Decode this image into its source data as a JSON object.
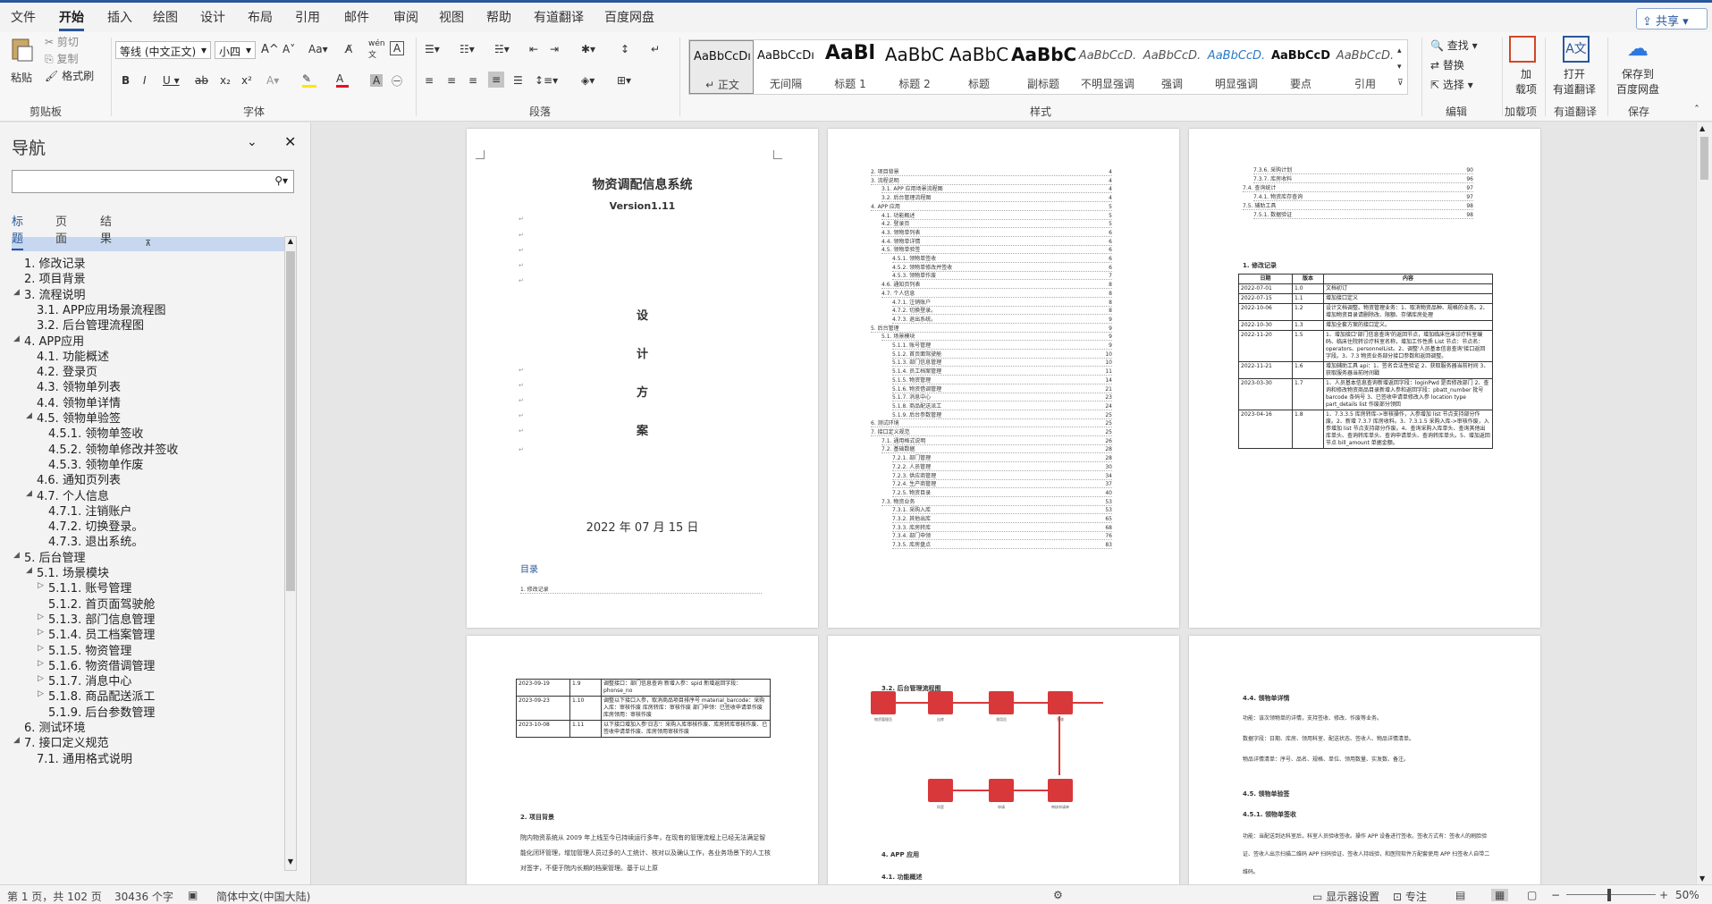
{
  "menu": {
    "tabs": [
      "文件",
      "开始",
      "插入",
      "绘图",
      "设计",
      "布局",
      "引用",
      "邮件",
      "审阅",
      "视图",
      "帮助",
      "有道翻译",
      "百度网盘"
    ],
    "active_tab": "开始",
    "share": "共享"
  },
  "ribbon": {
    "clipboard": {
      "paste": "粘贴",
      "cut": "剪切",
      "copy": "复制",
      "format_painter": "格式刷",
      "label": "剪贴板"
    },
    "font": {
      "name": "等线 (中文正文)",
      "size": "小四",
      "label": "字体",
      "wen": "wén"
    },
    "paragraph": {
      "label": "段落"
    },
    "styles": {
      "label": "样式",
      "items": [
        {
          "preview": "AaBbCcDı",
          "name": "正文"
        },
        {
          "preview": "AaBbCcDı",
          "name": "无间隔"
        },
        {
          "preview": "AaBl",
          "name": "标题 1"
        },
        {
          "preview": "AaBbC",
          "name": "标题 2"
        },
        {
          "preview": "AaBbC",
          "name": "标题"
        },
        {
          "preview": "AaBbC",
          "name": "副标题"
        },
        {
          "preview": "AaBbCcD.",
          "name": "不明显强调"
        },
        {
          "preview": "AaBbCcD.",
          "name": "强调"
        },
        {
          "preview": "AaBbCcD.",
          "name": "明显强调"
        },
        {
          "preview": "AaBbCcD",
          "name": "要点"
        },
        {
          "preview": "AaBbCcD.",
          "name": "引用"
        }
      ]
    },
    "editing": {
      "find": "查找",
      "replace": "替换",
      "select": "选择",
      "label": "编辑"
    },
    "addin": {
      "btn": "加\n载项",
      "label": "加载项"
    },
    "youdao": {
      "btn": "打开\n有道翻译",
      "label": "有道翻译"
    },
    "baidu": {
      "btn": "保存到\n百度网盘",
      "label": "保存"
    }
  },
  "nav": {
    "title": "导航",
    "tabs": [
      "标题",
      "页面",
      "结果"
    ],
    "items": [
      {
        "text": "1. 修改记录",
        "level": 1,
        "arrow": ""
      },
      {
        "text": "2. 项目背景",
        "level": 1,
        "arrow": ""
      },
      {
        "text": "3. 流程说明",
        "level": 1,
        "arrow": "▲"
      },
      {
        "text": "3.1. APP应用场景流程图",
        "level": 2,
        "arrow": ""
      },
      {
        "text": "3.2. 后台管理流程图",
        "level": 2,
        "arrow": ""
      },
      {
        "text": "4. APP应用",
        "level": 1,
        "arrow": "▲"
      },
      {
        "text": "4.1. 功能概述",
        "level": 2,
        "arrow": ""
      },
      {
        "text": "4.2. 登录页",
        "level": 2,
        "arrow": ""
      },
      {
        "text": "4.3. 领物单列表",
        "level": 2,
        "arrow": ""
      },
      {
        "text": "4.4. 领物单详情",
        "level": 2,
        "arrow": ""
      },
      {
        "text": "4.5. 领物单验签",
        "level": 2,
        "arrow": "▲"
      },
      {
        "text": "4.5.1. 领物单签收",
        "level": 3,
        "arrow": ""
      },
      {
        "text": "4.5.2. 领物单修改并签收",
        "level": 3,
        "arrow": ""
      },
      {
        "text": "4.5.3. 领物单作废",
        "level": 3,
        "arrow": ""
      },
      {
        "text": "4.6. 通知页列表",
        "level": 2,
        "arrow": ""
      },
      {
        "text": "4.7. 个人信息",
        "level": 2,
        "arrow": "▲"
      },
      {
        "text": "4.7.1. 注销账户",
        "level": 3,
        "arrow": ""
      },
      {
        "text": "4.7.2. 切换登录。",
        "level": 3,
        "arrow": ""
      },
      {
        "text": "4.7.3. 退出系统。",
        "level": 3,
        "arrow": ""
      },
      {
        "text": "5. 后台管理",
        "level": 1,
        "arrow": "▲"
      },
      {
        "text": "5.1. 场景模块",
        "level": 2,
        "arrow": "▲"
      },
      {
        "text": "5.1.1. 账号管理",
        "level": 3,
        "arrow": "▷"
      },
      {
        "text": "5.1.2. 首页面驾驶舱",
        "level": 3,
        "arrow": ""
      },
      {
        "text": "5.1.3. 部门信息管理",
        "level": 3,
        "arrow": "▷"
      },
      {
        "text": "5.1.4. 员工档案管理",
        "level": 3,
        "arrow": "▷"
      },
      {
        "text": "5.1.5. 物资管理",
        "level": 3,
        "arrow": "▷"
      },
      {
        "text": "5.1.6. 物资借调管理",
        "level": 3,
        "arrow": "▷"
      },
      {
        "text": "5.1.7. 消息中心",
        "level": 3,
        "arrow": "▷"
      },
      {
        "text": "5.1.8. 商品配送派工",
        "level": 3,
        "arrow": "▷"
      },
      {
        "text": "5.1.9. 后台参数管理",
        "level": 3,
        "arrow": ""
      },
      {
        "text": "6. 测试环境",
        "level": 1,
        "arrow": ""
      },
      {
        "text": "7. 接口定义规范",
        "level": 1,
        "arrow": "▲"
      },
      {
        "text": "7.1. 通用格式说明",
        "level": 2,
        "arrow": ""
      }
    ]
  },
  "pages": {
    "p1": {
      "title": "物资调配信息系统",
      "version": "Version1.11",
      "chars": [
        "设",
        "计",
        "方",
        "案"
      ],
      "date": "2022 年 07 月 15 日",
      "toc_head": "目录",
      "toc_first": "1.   修改记录"
    },
    "p2": {
      "toc": [
        [
          "2.  项目背景",
          "4"
        ],
        [
          "3.  流程说明",
          "4"
        ],
        [
          "3.1.  APP 应用场景流程图",
          "4"
        ],
        [
          "3.2.  后台管理流程图",
          "4"
        ],
        [
          "4.  APP 应用",
          "5"
        ],
        [
          "4.1.  功能概述",
          "5"
        ],
        [
          "4.2.  登录页",
          "5"
        ],
        [
          "4.3.  领物单列表",
          "6"
        ],
        [
          "4.4.  领物单详情",
          "6"
        ],
        [
          "4.5.  领物单验签",
          "6"
        ],
        [
          "4.5.1.  领物单签收",
          "6"
        ],
        [
          "4.5.2.  领物单修改并签收",
          "6"
        ],
        [
          "4.5.3.  领物单作废",
          "7"
        ],
        [
          "4.6.  通知页列表",
          "8"
        ],
        [
          "4.7.  个人信息",
          "8"
        ],
        [
          "4.7.1.  注销账户",
          "8"
        ],
        [
          "4.7.2.  切换登录。",
          "8"
        ],
        [
          "4.7.3.  退出系统。",
          "9"
        ],
        [
          "5.  后台管理",
          "9"
        ],
        [
          "5.1.  场景模块",
          "9"
        ],
        [
          "5.1.1.  账号管理",
          "9"
        ],
        [
          "5.1.2.  首页面驾驶舱",
          "10"
        ],
        [
          "5.1.3.  部门信息管理",
          "10"
        ],
        [
          "5.1.4.  员工档案管理",
          "11"
        ],
        [
          "5.1.5.  物资管理",
          "14"
        ],
        [
          "5.1.6.  物资借调管理",
          "21"
        ],
        [
          "5.1.7.  消息中心",
          "23"
        ],
        [
          "5.1.8.  商品配送派工",
          "24"
        ],
        [
          "5.1.9.  后台参数管理",
          "25"
        ],
        [
          "6.  测试环境",
          "25"
        ],
        [
          "7.  接口定义规范",
          "25"
        ],
        [
          "7.1.  通用格式说明",
          "26"
        ],
        [
          "7.2.  基础数据",
          "28"
        ],
        [
          "7.2.1.  部门管理",
          "28"
        ],
        [
          "7.2.2.  人员管理",
          "30"
        ],
        [
          "7.2.3.  供应商管理",
          "34"
        ],
        [
          "7.2.4.  生产商管理",
          "37"
        ],
        [
          "7.2.5.  物资目录",
          "40"
        ],
        [
          "7.3.  物资业务",
          "53"
        ],
        [
          "7.3.1.  采购入库",
          "53"
        ],
        [
          "7.3.2.  其他出库",
          "65"
        ],
        [
          "7.3.3.  库房转库",
          "68"
        ],
        [
          "7.3.4.  部门申领",
          "76"
        ],
        [
          "7.3.5.  库房盘点",
          "83"
        ]
      ]
    },
    "p3": {
      "toc": [
        [
          "7.3.6.  采购计划",
          "90"
        ],
        [
          "7.3.7.  库房收料",
          "96"
        ],
        [
          "7.4.  查询统计",
          "97"
        ],
        [
          "7.4.1.  物资库存查询",
          "97"
        ],
        [
          "7.5.  辅助工具",
          "98"
        ],
        [
          "7.5.1.  数据验证",
          "98"
        ]
      ],
      "heading": "1.  修改记录",
      "cols": [
        "日期",
        "版本",
        "内容"
      ],
      "rows": [
        [
          "2022-07-01",
          "1.0",
          "文档初订"
        ],
        [
          "2022-07-15",
          "1.1",
          "增加接口定义"
        ],
        [
          "2022-10-06",
          "1.2",
          "设计文档调整。物资管理业务：1、取消物资品种、规格的业务。2、增加物资目录请删除改、限额、存储库房处理"
        ],
        [
          "2022-10-30",
          "1.3",
          "增加全套方案的接口定义。"
        ],
        [
          "2022-11-20",
          "1.5",
          "1、增加接口'部门信息查询'的返回节点，增加临床住床诊疗科室编码、临床住院转诊疗科室名称，增加工作性质 List 节点：节点名：operators、personnelList。2、调整'人员基本信息查询'接口返回字段。3、7.3 物资业务部分接口参数和返回调整。"
        ],
        [
          "2022-11-21",
          "1.6",
          "增加辅助工具 api：1、签名合法性验证 2、获取服务器当前时间 3、获取服务器当前时间戳"
        ],
        [
          "2023-03-30",
          "1.7",
          "1、人员基本信息查询新增返回字段：loginPwd 是否修改部门 2、查询和修改物资商品目录新增入参和返回字段：pbatt_number 批号 barcode 条码号 3、已签收申请单修改入参 location type part_details list 作废部分领回"
        ],
        [
          "2023-04-16",
          "1.8",
          "1、7.3.3.5 库房转库->审核操作，入参增加 list 节点支持部分作废。2、新增 7.3.7 库房收料。3、7.3.1.5 采购入库->审核作废，入参增加 list 节点支持部分作废。4、查询采购入库单头、查询其他出库单头、查询转库单头、查询申请单头、查询转库单头。5、增加返回节点 bill_amount 单据金额。"
        ]
      ]
    },
    "p4": {
      "cols": [
        "",
        "",
        ""
      ],
      "rows": [
        [
          "2023-09-19",
          "1.9",
          "调整接口：部门信息查询 新增入参：spid 新增返回字段：phonse_no"
        ],
        [
          "2023-09-23",
          "1.10",
          "调整以下接口入参，取消商品项目排序号 material_barcode：采购入库：审核作废 库房转库：审核作废 部门申领：已签收申请单作废 库房领用：审核作废"
        ],
        [
          "2023-10-08",
          "1.11",
          "以下接口增加入参'日志'：采购入库审核作废、库房转库审核作废、已签收申请单作废、库房领用审核作废"
        ]
      ],
      "heading": "2.  项目背景",
      "body": "院内物资系统从 2009 年上线至今已持续运行多年，在现有的管理流程上已经无法满足智能化闭环管理，增加管理人员过多的人工统计、核对以及确认工作，各业务场景下的人工核对签字，不便于院内长期的档案管理。基于以上原"
    },
    "p5": {
      "heading": "3.2.  后台管理流程图",
      "heading2": "4.  APP 应用",
      "heading3": "4.1.  功能概述",
      "flow": [
        "物资管理员",
        "出库",
        "领用员",
        "签收",
        "作废",
        "审核申请单",
        "申请",
        "科室"
      ]
    },
    "p6": {
      "heading": "4.4.  领物单详情",
      "l1": "功能：该次领物单的详情，支持签收、修改、作废等业务。",
      "l2": "数据字段：日期、库房、领用科室、配送状态、签收人、物品详情清单。",
      "l3": "物品详情清单：序号、品名、规格、单位、领用数量、实发数、备注。",
      "heading2": "4.5.  领物单验签",
      "heading3": "4.5.1.  领物单签收",
      "l4": "功能：当配送到达科室后，科室人员验收签收。操作 APP 设备进行签收。签收方式有：签收人的刷脸验证、签收人出示扫描二维码 APP 扫码验证、签收人持线验，和医院软件方配套使用 APP 扫签收人自带二维码。"
    }
  },
  "status": {
    "page": "第 1 页，共 102 页",
    "words": "30436 个字",
    "lang": "简体中文(中国大陆)",
    "display": "显示器设置",
    "focus": "专注",
    "zoom": "50%"
  }
}
